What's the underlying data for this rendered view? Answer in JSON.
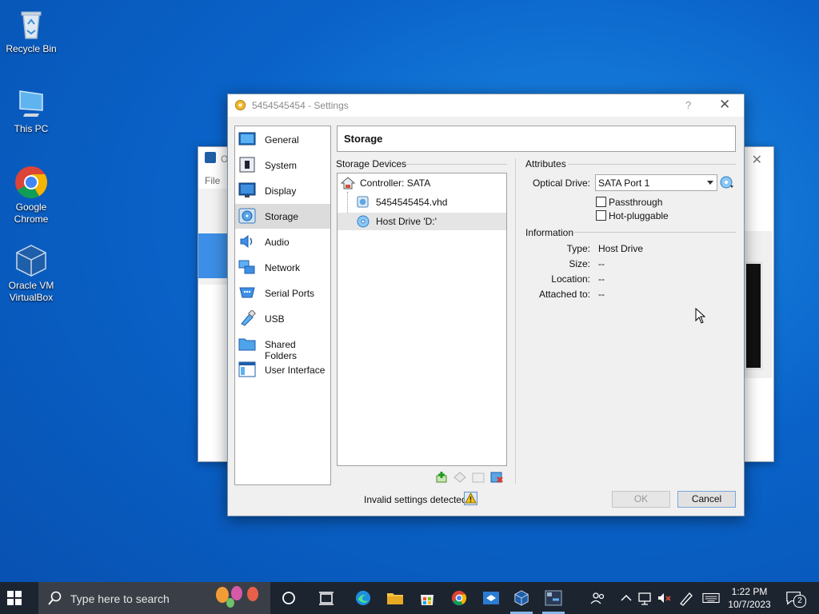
{
  "desktop": {
    "icons": [
      {
        "label": "Recycle Bin"
      },
      {
        "label": "This PC"
      },
      {
        "label": "Google Chrome"
      },
      {
        "label": "Oracle VM VirtualBox"
      }
    ]
  },
  "background_window": {
    "menu_label": "File",
    "title_fragment": "O"
  },
  "dialog": {
    "title": "5454545454 - Settings",
    "help": "?",
    "close": "✕",
    "nav": [
      {
        "label": "General",
        "icon": "general-icon"
      },
      {
        "label": "System",
        "icon": "system-icon"
      },
      {
        "label": "Display",
        "icon": "display-icon"
      },
      {
        "label": "Storage",
        "icon": "storage-icon",
        "active": true
      },
      {
        "label": "Audio",
        "icon": "audio-icon"
      },
      {
        "label": "Network",
        "icon": "network-icon"
      },
      {
        "label": "Serial Ports",
        "icon": "serial-ports-icon"
      },
      {
        "label": "USB",
        "icon": "usb-icon"
      },
      {
        "label": "Shared Folders",
        "icon": "shared-folders-icon"
      },
      {
        "label": "User Interface",
        "icon": "user-interface-icon"
      }
    ],
    "page_title": "Storage",
    "storage_devices": {
      "label": "Storage Devices",
      "controller": "Controller: SATA",
      "items": [
        {
          "label": "5454545454.vhd",
          "icon": "hard-disk-icon"
        },
        {
          "label": "Host Drive 'D:'",
          "icon": "optical-disc-icon",
          "selected": true
        }
      ]
    },
    "attributes": {
      "label": "Attributes",
      "optical_drive_label": "Optical Drive:",
      "optical_drive_value": "SATA Port 1",
      "passthrough_label": "Passthrough",
      "hotpluggable_label": "Hot-pluggable"
    },
    "information": {
      "label": "Information",
      "type_label": "Type:",
      "type_value": "Host Drive",
      "size_label": "Size:",
      "size_value": "--",
      "location_label": "Location:",
      "location_value": "--",
      "attached_label": "Attached to:",
      "attached_value": "--"
    },
    "status_text": "Invalid settings detected",
    "ok_label": "OK",
    "cancel_label": "Cancel"
  },
  "taskbar": {
    "search_placeholder": "Type here to search",
    "time": "1:22 PM",
    "date": "10/7/2023",
    "notification_count": "2"
  },
  "colors": {
    "desktop_blue": "#0a63c9",
    "taskbar": "#1c2430",
    "selection": "#dcdcdc"
  }
}
